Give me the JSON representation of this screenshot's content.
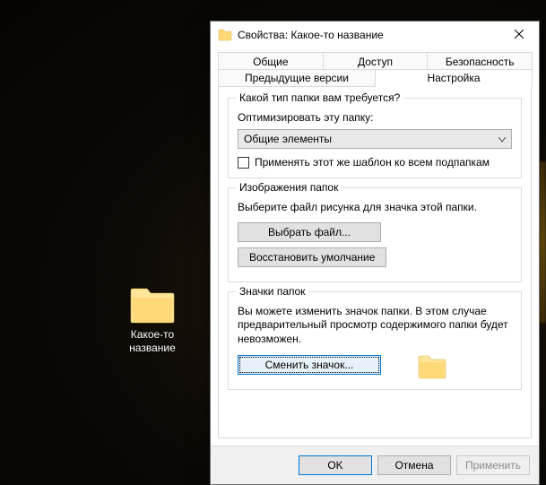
{
  "desktop": {
    "folder_label": "Какое-то название"
  },
  "dialog": {
    "title": "Свойства: Какое-то название",
    "tabs": {
      "row1": [
        "Общие",
        "Доступ",
        "Безопасность"
      ],
      "row2": [
        "Предыдущие версии",
        "Настройка"
      ]
    },
    "active_tab": "Настройка",
    "group_type": {
      "legend": "Какой тип папки вам требуется?",
      "optimize_label": "Оптимизировать эту папку:",
      "optimize_value": "Общие элементы",
      "checkbox_label": "Применять этот же шаблон ко всем подпапкам"
    },
    "group_images": {
      "legend": "Изображения папок",
      "desc": "Выберите файл рисунка для значка этой папки.",
      "choose_file_btn": "Выбрать файл...",
      "restore_btn": "Восстановить умолчание"
    },
    "group_icons": {
      "legend": "Значки папок",
      "desc": "Вы можете изменить значок папки. В этом случае предварительный просмотр содержимого папки будет невозможен.",
      "change_icon_btn": "Сменить значок..."
    },
    "footer": {
      "ok": "OK",
      "cancel": "Отмена",
      "apply": "Применить"
    }
  }
}
